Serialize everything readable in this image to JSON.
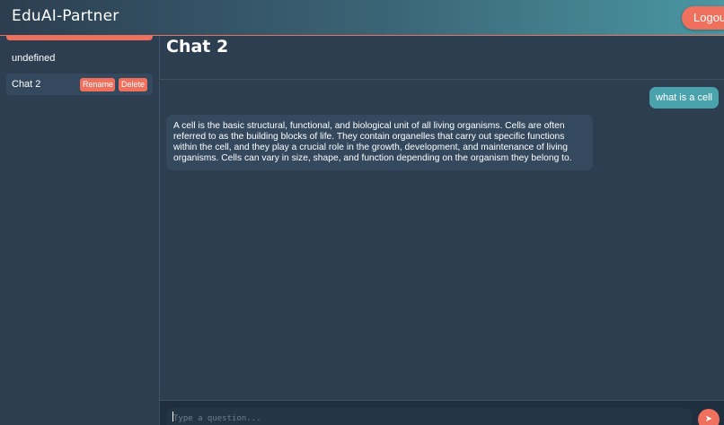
{
  "header": {
    "brand": "EduAI-Partner",
    "logout_label": "Logout"
  },
  "sidebar": {
    "items": [
      {
        "label": "undefined"
      },
      {
        "label": "Chat 2",
        "rename_label": "Rename",
        "delete_label": "Delete"
      }
    ]
  },
  "main": {
    "title": "Chat 2",
    "messages": [
      {
        "role": "user",
        "text": "what is a cell"
      },
      {
        "role": "assistant",
        "text": "A cell is the basic structural, functional, and biological unit of all living organisms. Cells are often referred to as the building blocks of life. They contain organelles that carry out specific functions within the cell, and they play a crucial role in the growth, development, and maintenance of living organisms. Cells can vary in size, shape, and function depending on the organism they belong to."
      }
    ],
    "input_placeholder": "Type a question...",
    "send_icon": "send-icon"
  },
  "colors": {
    "accent": "#f0705e",
    "user_bubble": "#4aa3ac",
    "background": "#2c3e50",
    "bot_bubble": "#34495e"
  }
}
